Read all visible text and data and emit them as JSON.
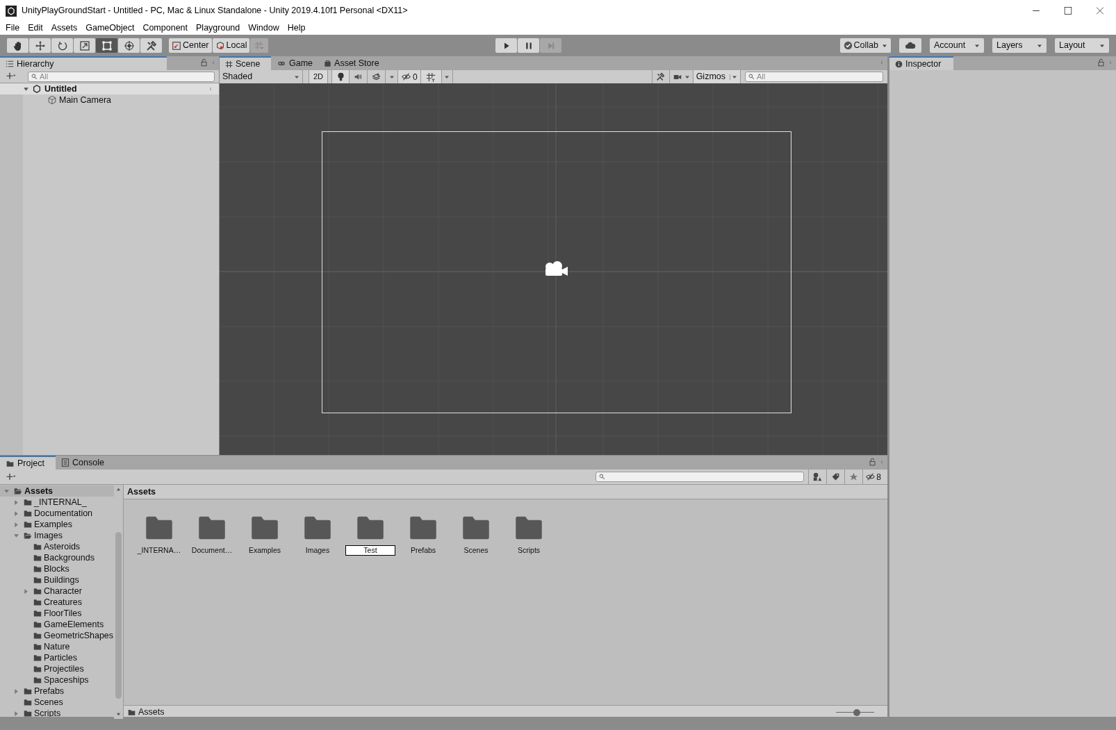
{
  "window": {
    "title": "UnityPlayGroundStart - Untitled - PC, Mac & Linux Standalone - Unity 2019.4.10f1 Personal <DX11>"
  },
  "menu": [
    "File",
    "Edit",
    "Assets",
    "GameObject",
    "Component",
    "Playground",
    "Window",
    "Help"
  ],
  "toolbar": {
    "tools": [
      {
        "kind": "hand",
        "selected": false
      },
      {
        "kind": "move",
        "selected": false
      },
      {
        "kind": "rotate",
        "selected": false
      },
      {
        "kind": "scale",
        "selected": false
      },
      {
        "kind": "rect",
        "selected": true
      },
      {
        "kind": "transform",
        "selected": false
      },
      {
        "kind": "custom",
        "selected": false
      }
    ],
    "pivot": [
      {
        "kind": "center",
        "label": "Center"
      },
      {
        "kind": "local",
        "label": "Local"
      }
    ],
    "playback": [
      {
        "kind": "play",
        "disabled": false
      },
      {
        "kind": "pause",
        "disabled": false
      },
      {
        "kind": "step",
        "disabled": true
      }
    ],
    "collab": "Collab",
    "dropdowns": [
      "Account",
      "Layers",
      "Layout"
    ]
  },
  "hierarchy": {
    "tab": "Hierarchy",
    "search": {
      "placeholder": "All"
    },
    "tree": [
      {
        "label": "Untitled",
        "kind": "scene",
        "expanded": true,
        "children": [
          {
            "label": "Main Camera",
            "kind": "object"
          }
        ]
      }
    ]
  },
  "scene": {
    "tabs": [
      {
        "label": "Scene",
        "kind": "scene",
        "selected": true
      },
      {
        "label": "Game",
        "kind": "game",
        "selected": false
      },
      {
        "label": "Asset Store",
        "kind": "store",
        "selected": false
      }
    ],
    "shading": "Shaded",
    "mode_2d": "2D",
    "hidden_count": "0",
    "gizmos": "Gizmos",
    "search": {
      "placeholder": "All"
    }
  },
  "inspector": {
    "tab": "Inspector"
  },
  "project": {
    "tabs": [
      {
        "label": "Project",
        "kind": "project",
        "selected": true
      },
      {
        "label": "Console",
        "kind": "console",
        "selected": false
      }
    ],
    "hidden_count": "8",
    "tree": [
      {
        "label": "Assets",
        "expanded": true,
        "selected": true,
        "children": [
          {
            "label": "_INTERNAL_",
            "expanded": false,
            "selected": false
          },
          {
            "label": "Documentation",
            "expanded": false,
            "selected": false
          },
          {
            "label": "Examples",
            "expanded": false,
            "selected": false
          },
          {
            "label": "Images",
            "expanded": true,
            "selected": false,
            "children": [
              {
                "label": "Asteroids",
                "selected": false
              },
              {
                "label": "Backgrounds",
                "selected": false
              },
              {
                "label": "Blocks",
                "selected": false
              },
              {
                "label": "Buildings",
                "selected": false
              },
              {
                "label": "Character",
                "expanded": false,
                "selected": false
              },
              {
                "label": "Creatures",
                "selected": false
              },
              {
                "label": "FloorTiles",
                "selected": false
              },
              {
                "label": "GameElements",
                "selected": false
              },
              {
                "label": "GeometricShapes",
                "selected": false
              },
              {
                "label": "Nature",
                "selected": false
              },
              {
                "label": "Particles",
                "selected": false
              },
              {
                "label": "Projectiles",
                "selected": false
              },
              {
                "label": "Spaceships",
                "selected": false
              }
            ]
          },
          {
            "label": "Prefabs",
            "expanded": false,
            "selected": false
          },
          {
            "label": "Scenes",
            "selected": false
          },
          {
            "label": "Scripts",
            "expanded": false,
            "selected": false
          }
        ]
      }
    ],
    "header": "Assets",
    "items": [
      {
        "label": "_INTERNA…",
        "renaming": false
      },
      {
        "label": "Document…",
        "renaming": false
      },
      {
        "label": "Examples",
        "renaming": false
      },
      {
        "label": "Images",
        "renaming": false
      },
      {
        "label": "Test",
        "renaming": true
      },
      {
        "label": "Prefabs",
        "renaming": false
      },
      {
        "label": "Scenes",
        "renaming": false
      },
      {
        "label": "Scripts",
        "renaming": false
      }
    ],
    "path": "Assets",
    "zoom": {
      "level": 0.55
    }
  }
}
